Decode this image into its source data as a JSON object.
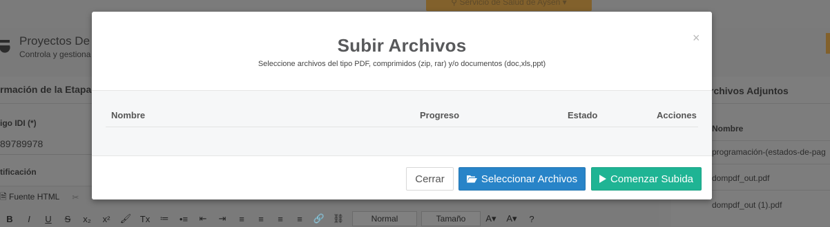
{
  "background": {
    "service_label": "Servicio de Salud de Aysén",
    "project": {
      "title": "Proyectos De",
      "subtitle": "Controla y gestiona"
    },
    "left_panel": {
      "heading": "rmación de la Etapa",
      "codigo_label": "igo IDI (*)",
      "codigo_value": "89789978",
      "justificacion_label": "tificación",
      "toolbar_row1": [
        "Fuente HTML",
        "✂"
      ],
      "toolbar_row2_icons": [
        "B",
        "I",
        "U",
        "S",
        "x₂",
        "x²",
        "🖌",
        "Tx",
        "≔",
        "•≡",
        "⇤",
        "⇥",
        "≡",
        "≡",
        "≡",
        "≡",
        "🔗",
        "⛓",
        "",
        "",
        "",
        "",
        "?"
      ],
      "format_select": "Normal",
      "size_select": "Tamaño"
    },
    "right_panel": {
      "heading": "rchivos Adjuntos",
      "column": "Nombre",
      "files": [
        "programación-(estados-de-pag",
        "dompdf_out.pdf",
        "dompdf_out (1).pdf"
      ]
    }
  },
  "modal": {
    "title": "Subir Archivos",
    "subtitle": "Seleccione archivos del tipo PDF, comprimidos (zip, rar) y/o documentos (doc,xls,ppt)",
    "close_symbol": "×",
    "table": {
      "columns": [
        "Nombre",
        "Progreso",
        "Estado",
        "Acciones"
      ],
      "rows": []
    },
    "footer": {
      "close_label": "Cerrar",
      "select_label": "Seleccionar Archivos",
      "start_label": "Comenzar Subida"
    }
  },
  "colors": {
    "primary": "#2884c8",
    "success": "#1fb494",
    "overlay": "#7b7b7b",
    "accent_orange": "#82612c"
  },
  "icons": {
    "select": "folder-open-icon",
    "start": "play-icon",
    "close": "close-icon"
  }
}
